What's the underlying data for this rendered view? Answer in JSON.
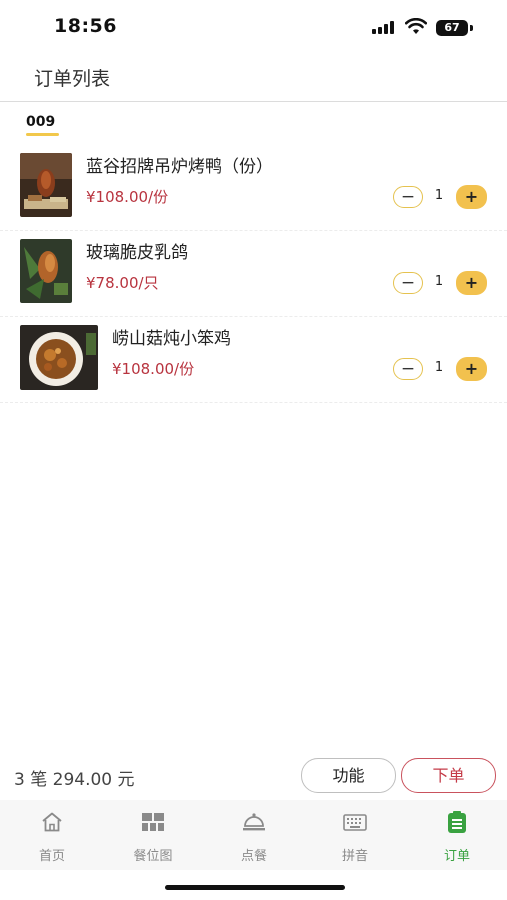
{
  "status_bar": {
    "time": "18:56",
    "battery": "67"
  },
  "header": {
    "title": "订单列表"
  },
  "order_group": {
    "label": "009"
  },
  "items": [
    {
      "name": "蓝谷招牌吊炉烤鸭（份）",
      "price": "¥108.00/份",
      "qty": "1"
    },
    {
      "name": "玻璃脆皮乳鸽",
      "price": "¥78.00/只",
      "qty": "1"
    },
    {
      "name": "崂山菇炖小笨鸡",
      "price": "¥108.00/份",
      "qty": "1"
    }
  ],
  "controls": {
    "minus": "−",
    "plus": "+"
  },
  "footer": {
    "summary": "3 笔  294.00 元",
    "func_label": "功能",
    "order_label": "下单"
  },
  "tabbar": {
    "tabs": [
      {
        "label": "首页",
        "icon": "home-icon"
      },
      {
        "label": "餐位图",
        "icon": "table-map-icon"
      },
      {
        "label": "点餐",
        "icon": "cloche-icon"
      },
      {
        "label": "拼音",
        "icon": "keyboard-icon"
      },
      {
        "label": "订单",
        "icon": "order-clipboard-icon"
      }
    ],
    "active_color": "#3aa241",
    "inactive_color": "#8a8a8a"
  },
  "colors": {
    "accent_yellow": "#f2c14e",
    "price_red": "#b8343f",
    "order_red": "#c43a47"
  }
}
